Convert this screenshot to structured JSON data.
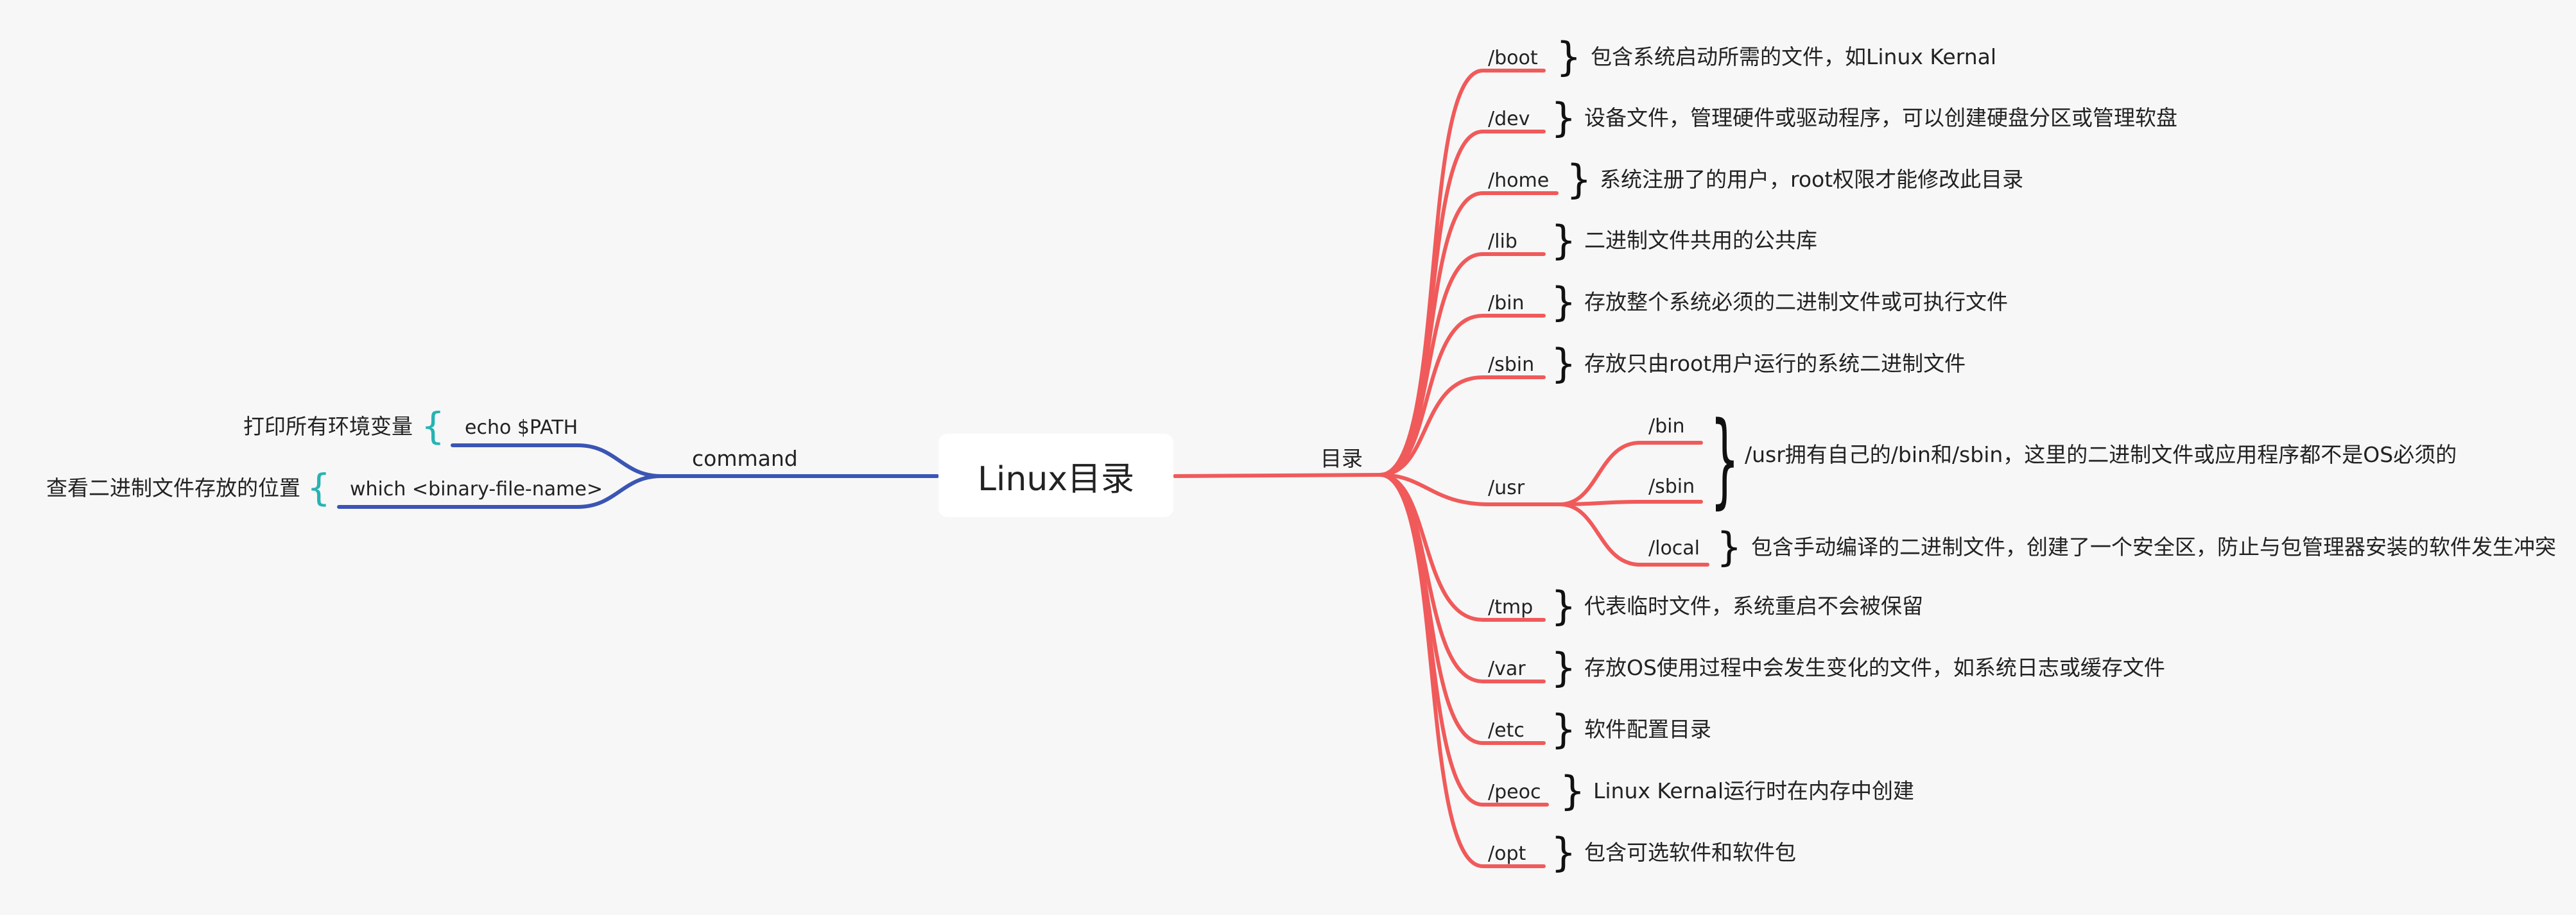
{
  "root": {
    "label": "Linux目录"
  },
  "left_branch": {
    "label": "command",
    "items": [
      {
        "command": "echo $PATH",
        "desc": "打印所有环境变量"
      },
      {
        "command": "which  <binary-file-name>",
        "desc": "查看二进制文件存放的位置"
      }
    ]
  },
  "right_branch": {
    "label": "目录",
    "items": [
      {
        "dir": "/boot",
        "desc": "包含系统启动所需的文件，如Linux Kernal"
      },
      {
        "dir": "/dev",
        "desc": "设备文件，管理硬件或驱动程序，可以创建硬盘分区或管理软盘"
      },
      {
        "dir": "/home",
        "desc": "系统注册了的用户，root权限才能修改此目录"
      },
      {
        "dir": "/lib",
        "desc": "二进制文件共用的公共库"
      },
      {
        "dir": "/bin",
        "desc": "存放整个系统必须的二进制文件或可执行文件"
      },
      {
        "dir": "/sbin",
        "desc": "存放只由root用户运行的系统二进制文件"
      },
      {
        "dir": "/usr",
        "children": [
          {
            "dir": "/bin"
          },
          {
            "dir": "/sbin"
          },
          {
            "dir": "/local",
            "desc": "包含手动编译的二进制文件，创建了一个安全区，防止与包管理器安装的软件发生冲突"
          }
        ],
        "group_desc": "/usr拥有自己的/bin和/sbin，这里的二进制文件或应用程序都不是OS必须的"
      },
      {
        "dir": "/tmp",
        "desc": "代表临时文件，系统重启不会被保留"
      },
      {
        "dir": "/var",
        "desc": "存放OS使用过程中会发生变化的文件，如系统日志或缓存文件"
      },
      {
        "dir": "/etc",
        "desc": "软件配置目录"
      },
      {
        "dir": "/peoc",
        "desc": "Linux Kernal运行时在内存中创建"
      },
      {
        "dir": "/opt",
        "desc": "包含可选软件和软件包"
      }
    ]
  },
  "colors": {
    "right_lines": "#f05a5a",
    "left_lines": "#3a55b4",
    "left_braces": "#26b3b3",
    "background": "#f7f7f7"
  }
}
